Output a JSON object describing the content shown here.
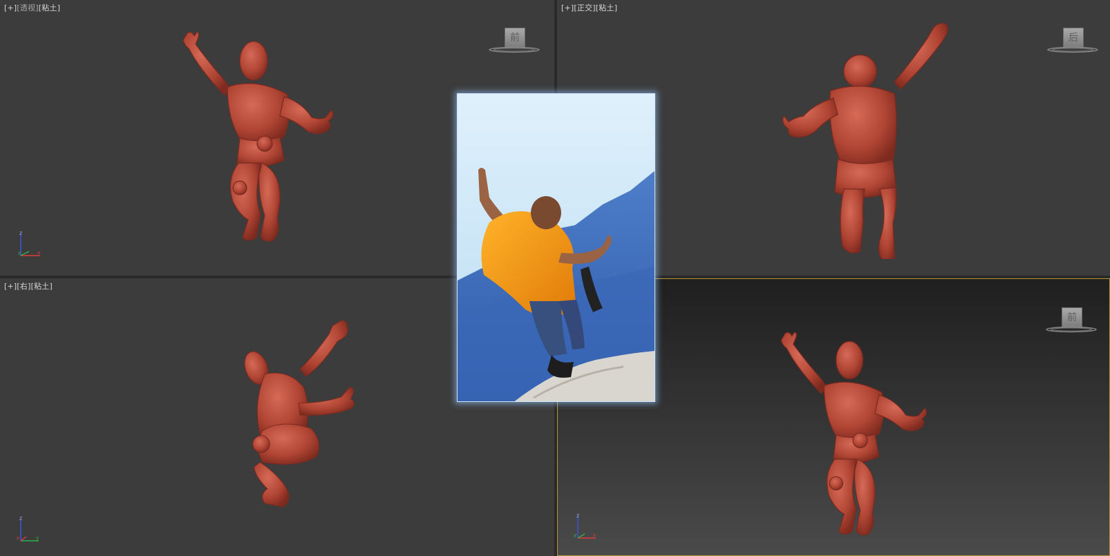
{
  "viewports": {
    "top_left": {
      "labels": [
        "[+]",
        "[透视]",
        "[粘土]"
      ],
      "viewcube_face": "前",
      "axis": {
        "up": "z",
        "left": "y",
        "right": "x"
      }
    },
    "top_right": {
      "labels": [
        "[+]",
        "[正交]",
        "[粘土]"
      ],
      "viewcube_face": "后"
    },
    "bottom_left": {
      "labels": [
        "[+]",
        "[右]",
        "[粘土]"
      ],
      "axis": {
        "up": "z",
        "left": "x",
        "right": "y"
      }
    },
    "bottom_right": {
      "labels": [],
      "viewcube_face": "前",
      "axis": {
        "up": "z",
        "left": "y",
        "right": "x"
      },
      "active": true
    }
  },
  "reference_photo": {
    "icon": "monk-kungfu-reference-photo"
  },
  "colors": {
    "model": "#b84a3a",
    "active_border": "#b8972e",
    "photo_glow": "#96c8ff",
    "axis_x": "#e23b3b",
    "axis_y": "#2fb24a",
    "axis_z": "#3a55e6"
  }
}
